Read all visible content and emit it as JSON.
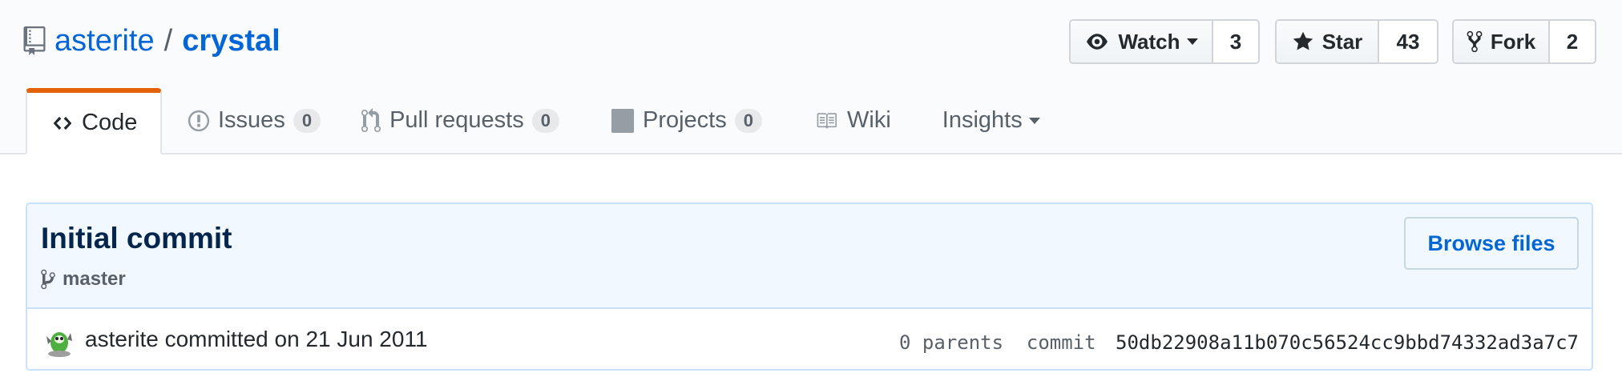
{
  "repo": {
    "owner": "asterite",
    "separator": "/",
    "name": "crystal"
  },
  "actions": {
    "watch": {
      "label": "Watch",
      "count": "3"
    },
    "star": {
      "label": "Star",
      "count": "43"
    },
    "fork": {
      "label": "Fork",
      "count": "2"
    }
  },
  "tabs": [
    {
      "label": "Code",
      "icon": "code-icon",
      "active": true
    },
    {
      "label": "Issues",
      "icon": "issue-icon",
      "count": "0"
    },
    {
      "label": "Pull requests",
      "icon": "pull-request-icon",
      "count": "0"
    },
    {
      "label": "Projects",
      "icon": "project-icon",
      "count": "0"
    },
    {
      "label": "Wiki",
      "icon": "book-icon"
    },
    {
      "label": "Insights",
      "icon": "chevron-down-icon"
    }
  ],
  "commit": {
    "message": "Initial commit",
    "branch": "master",
    "browse_label": "Browse files",
    "author": "asterite",
    "committed_text": "committed on 21 Jun 2011",
    "parents_text": "0 parents",
    "commit_label": "commit",
    "sha": "50db22908a11b070c56524cc9bbd74332ad3a7c7"
  },
  "colors": {
    "link": "#0366d6",
    "active_tab_accent": "#e36209",
    "commit_header_bg": "#f1f8ff",
    "commit_border": "#c8e1ff"
  }
}
